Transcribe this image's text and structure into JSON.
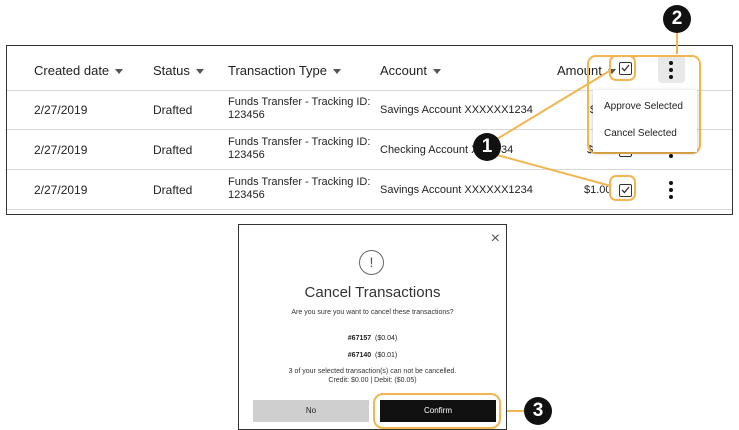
{
  "table": {
    "headers": {
      "created": "Created date",
      "status": "Status",
      "type": "Transaction Type",
      "account": "Account",
      "amount": "Amount"
    },
    "rows": [
      {
        "date": "2/27/2019",
        "status": "Drafted",
        "type": "Funds Transfer - Tracking ID: 123456",
        "account": "Savings Account XXXXXX1234",
        "amount": "$1"
      },
      {
        "date": "2/27/2019",
        "status": "Drafted",
        "type": "Funds Transfer - Tracking ID: 123456",
        "account": "Checking Account XX",
        "account_tail": "34",
        "amount": "$0.50"
      },
      {
        "date": "2/27/2019",
        "status": "Drafted",
        "type": "Funds Transfer - Tracking ID: 123456",
        "account": "Savings Account XXXXXX1234",
        "amount": "$1.00"
      }
    ]
  },
  "menu": {
    "approve": "Approve Selected",
    "cancel": "Cancel Selected"
  },
  "callouts": {
    "one": "1",
    "two": "2",
    "three": "3"
  },
  "modal": {
    "title": "Cancel Transactions",
    "question": "Are you sure you want to cancel these transactions?",
    "items": [
      {
        "id": "#67157",
        "amount": "($0.04)"
      },
      {
        "id": "#67140",
        "amount": "($0.01)"
      }
    ],
    "note": "3 of your selected transaction(s) can not be cancelled.",
    "totals": "Credit: $0.00 | Debit: ($0.05)",
    "no_label": "No",
    "confirm_label": "Confirm",
    "close_glyph": "×",
    "alert_glyph": "!"
  },
  "colors": {
    "highlight": "#f2b650",
    "confirm_bg": "#111111",
    "no_bg": "#cfcfcf"
  }
}
